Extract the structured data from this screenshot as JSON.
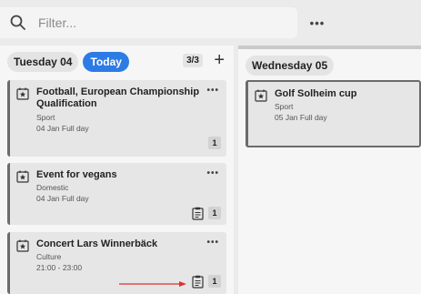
{
  "filter": {
    "placeholder": "Filter..."
  },
  "topbar": {
    "more_label": "•••"
  },
  "columns": [
    {
      "day": "Tuesday 04",
      "today_label": "Today",
      "count": "3/3",
      "add_label": "+",
      "events": [
        {
          "title": "Football, European Championship Qualification",
          "category": "Sport",
          "when": "04 Jan Full day",
          "badge": "1",
          "more": "•••"
        },
        {
          "title": "Event for vegans",
          "category": "Domestic",
          "when": "04 Jan Full day",
          "badge": "1",
          "more": "•••"
        },
        {
          "title": "Concert Lars Winnerbäck",
          "category": "Culture",
          "when": "21:00 - 23:00",
          "badge": "1",
          "more": "•••"
        }
      ]
    },
    {
      "day": "Wednesday 05",
      "events": [
        {
          "title": "Golf Solheim cup",
          "category": "Sport",
          "when": "05 Jan Full day"
        }
      ]
    }
  ],
  "colors": {
    "accent": "#2d7be5",
    "arrow": "#e03030",
    "card_border": "#6b6b6b"
  },
  "icons": {
    "search": "search-icon",
    "event": "event-star-icon",
    "planning": "clipboard-icon"
  }
}
